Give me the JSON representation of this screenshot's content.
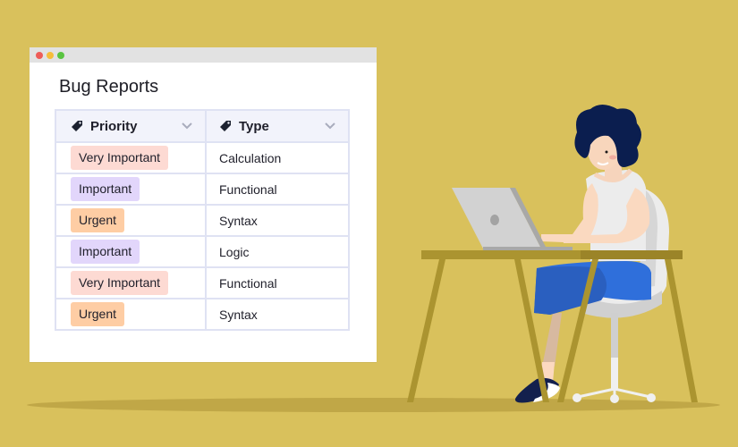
{
  "window": {
    "controls": [
      {
        "name": "close",
        "color": "#ee5c58"
      },
      {
        "name": "minimize",
        "color": "#f6bd3b"
      },
      {
        "name": "maximize",
        "color": "#5ac441"
      }
    ],
    "title": "Bug Reports"
  },
  "table": {
    "columns": [
      {
        "label": "Priority",
        "icon": "tag-icon",
        "sort_icon": "chevron-down-icon"
      },
      {
        "label": "Type",
        "icon": "tag-icon",
        "sort_icon": "chevron-down-icon"
      }
    ],
    "rows": [
      {
        "priority": "Very Important",
        "type": "Calculation"
      },
      {
        "priority": "Important",
        "type": "Functional"
      },
      {
        "priority": "Urgent",
        "type": "Syntax"
      },
      {
        "priority": "Important",
        "type": "Logic"
      },
      {
        "priority": "Very Important",
        "type": "Functional"
      },
      {
        "priority": "Urgent",
        "type": "Syntax"
      }
    ],
    "priority_colors": {
      "Very Important": "#fddad3",
      "Important": "#e2d6fb",
      "Urgent": "#fecda4"
    }
  },
  "colors": {
    "background": "#d9c15c",
    "shadow": "#c0a747",
    "table_border": "#dfe2f3",
    "header_bg": "#f2f3fb"
  },
  "illustration": {
    "subject": "woman typing on laptop at desk",
    "items": [
      "desk",
      "laptop",
      "person",
      "chair"
    ]
  }
}
